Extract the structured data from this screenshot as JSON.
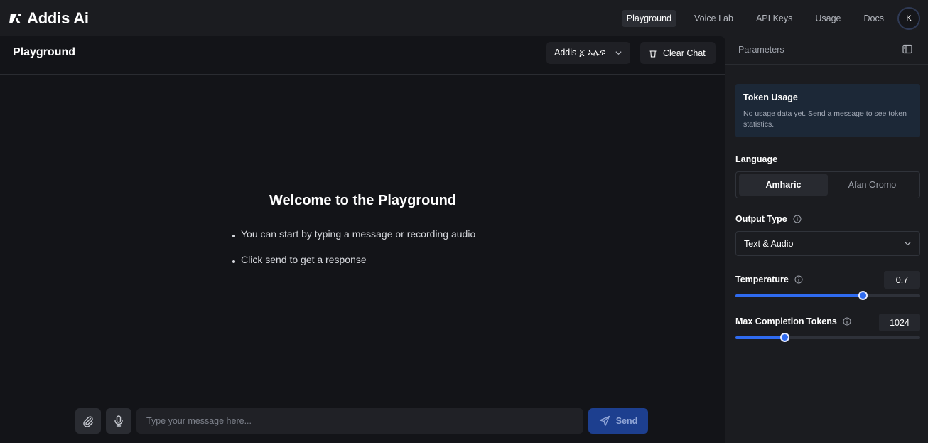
{
  "app": {
    "logo_text": "Addis Ai"
  },
  "nav": {
    "items": [
      {
        "label": "Playground",
        "active": true
      },
      {
        "label": "Voice Lab",
        "active": false
      },
      {
        "label": "API Keys",
        "active": false
      },
      {
        "label": "Usage",
        "active": false
      },
      {
        "label": "Docs",
        "active": false
      }
    ],
    "avatar_initial": "K"
  },
  "main": {
    "title": "Playground",
    "model_select": {
      "value": "Addis-፩-አሌፍ",
      "icon": "chevron-down-icon"
    },
    "clear_button": {
      "label": "Clear Chat",
      "icon": "trash-icon"
    },
    "welcome_title": "Welcome to the Playground",
    "tips": [
      "You can start by typing a message or recording audio",
      "Click send to get a response"
    ]
  },
  "composer": {
    "attach_icon": "paperclip-icon",
    "mic_icon": "microphone-icon",
    "placeholder": "Type your message here...",
    "send_label": "Send",
    "send_icon": "send-icon"
  },
  "side": {
    "title": "Parameters",
    "token_usage": {
      "title": "Token Usage",
      "description": "No usage data yet. Send a message to see token statistics."
    },
    "language": {
      "label": "Language",
      "options": [
        "Amharic",
        "Afan Oromo"
      ],
      "selected": "Amharic"
    },
    "output_type": {
      "label": "Output Type",
      "value": "Text & Audio"
    },
    "temperature": {
      "label": "Temperature",
      "value": "0.7",
      "fraction": 0.69
    },
    "max_tokens": {
      "label": "Max Completion Tokens",
      "value": "1024",
      "fraction": 0.265
    }
  },
  "colors": {
    "accent": "#2f6bf0",
    "send_button": "#1d3f8f",
    "token_card": "#1c2837"
  }
}
